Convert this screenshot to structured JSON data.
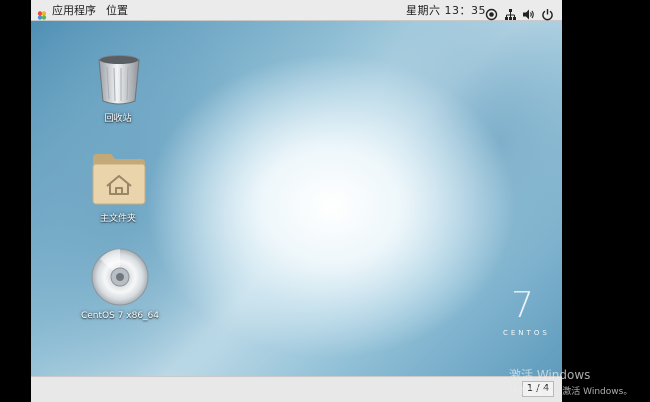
{
  "topbar": {
    "apps_label": "应用程序",
    "places_label": "位置",
    "clock": "星期六 13：35",
    "tray_icons": [
      "accessibility-icon",
      "network-icon",
      "volume-icon",
      "power-icon"
    ]
  },
  "desktop": {
    "icons": [
      {
        "label": "回收站",
        "icon": "trash-icon"
      },
      {
        "label": "主文件夹",
        "icon": "home-folder-icon"
      },
      {
        "label": "CentOS 7 x86_64",
        "icon": "optical-disc-icon"
      }
    ],
    "branding": {
      "number": "7",
      "name": "CENTOS"
    }
  },
  "bottombar": {
    "workspace_pager": "1 / 4"
  },
  "watermark": {
    "title": "激活 Windows",
    "subtitle": "转到\"设置\"以激活 Windows。"
  },
  "colors": {
    "panel_bg": "#ebebeb",
    "outer_bg": "#000000",
    "wallpaper_blue": "#5f9bbd"
  }
}
